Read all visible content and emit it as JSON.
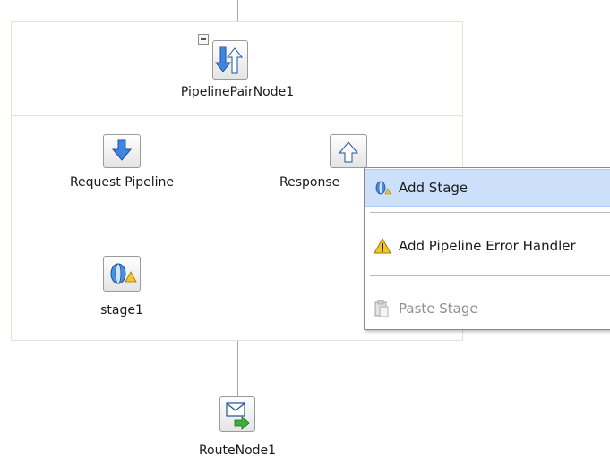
{
  "nodes": {
    "pipeline_pair": "PipelinePairNode1",
    "request_pipeline": "Request Pipeline",
    "response_pipeline": "Response",
    "stage": "stage1",
    "route_node": "RouteNode1"
  },
  "context_menu": {
    "items": [
      {
        "label": "Add Stage",
        "icon": "stage-icon",
        "state": "highlighted"
      },
      {
        "label": "Add Pipeline Error Handler",
        "icon": "warning-icon",
        "state": "enabled"
      },
      {
        "label": "Paste Stage",
        "icon": "paste-icon",
        "state": "disabled"
      }
    ]
  },
  "colors": {
    "highlight": "#cce0fb",
    "accent_blue": "#3b7ad8",
    "disabled_text": "#8f8f8f",
    "box_border": "#e6e1d6"
  }
}
